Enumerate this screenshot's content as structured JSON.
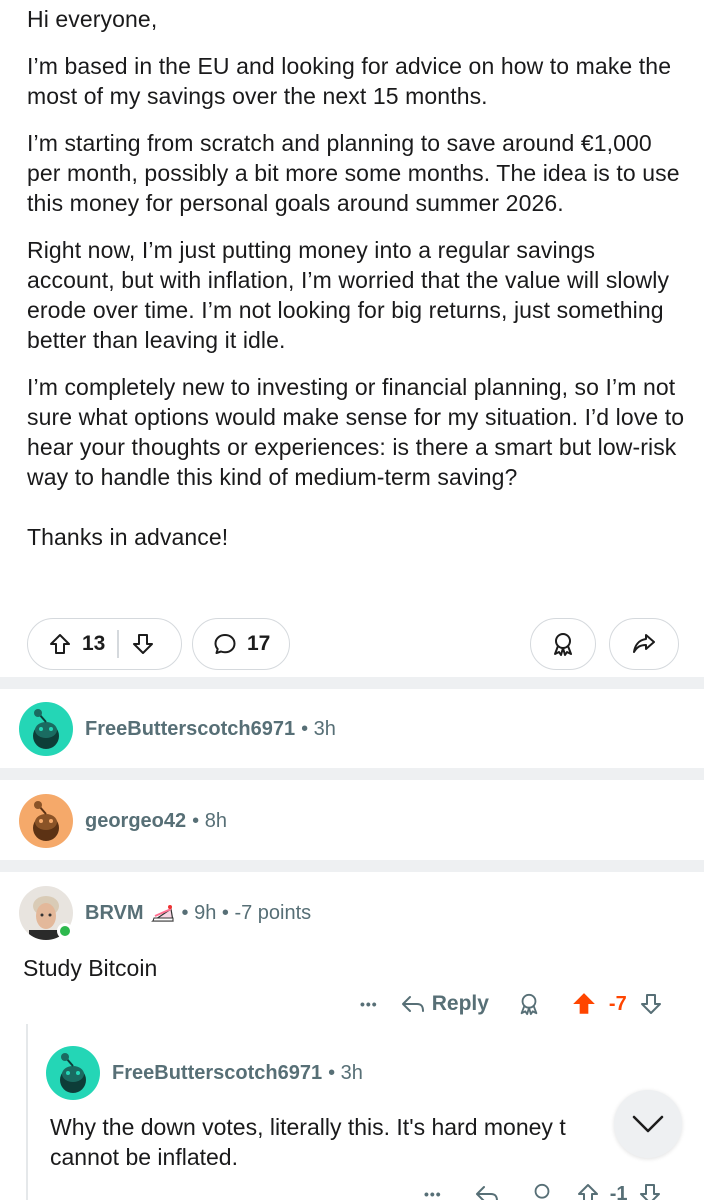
{
  "post": {
    "paragraphs": [
      "Hi everyone,",
      "I’m based in the EU and looking for advice on how to make the most of my savings over the next 15 months.",
      "I’m starting from scratch and planning to save around €1,000 per month, possibly a bit more some months. The idea is to use this money for personal goals around summer 2026.",
      "Right now, I’m just putting money into a regular savings account, but with inflation, I’m worried that the value will slowly erode over time. I’m not looking for big returns, just something better than leaving it idle.",
      "I’m completely new to investing or financial planning, so I’m not sure what options would make sense for my situation. I’d love to hear your thoughts or experiences: is there a smart but low-risk way to handle this kind of medium-term saving?",
      "Thanks in advance!"
    ],
    "upvotes": "13",
    "comments": "17"
  },
  "comments": [
    {
      "author": "FreeButterscotch6971",
      "meta": "• 3h",
      "avatar_color": "#24d6b6"
    },
    {
      "author": "georgeo42",
      "meta": "• 8h",
      "avatar_color": "#f5a96a"
    },
    {
      "author": "BRVM",
      "flair_icon": "cake-icon",
      "meta": "• 9h • -7 points",
      "text": "Study Bitcoin",
      "more": "•••",
      "reply_label": "Reply",
      "score": "-7",
      "score_color": "#ff4500"
    }
  ],
  "reply": {
    "author": "FreeButterscotch6971",
    "meta": "• 3h",
    "avatar_color": "#24d6b6",
    "text_line1": "Why the down votes, literally this. It's hard money t",
    "text_line2": "cannot be inflated.",
    "more": "•••",
    "score": "-1"
  },
  "colors": {
    "meta": "#576f76",
    "downvote_accent": "#ff4500",
    "separator": "#eef0f2"
  }
}
